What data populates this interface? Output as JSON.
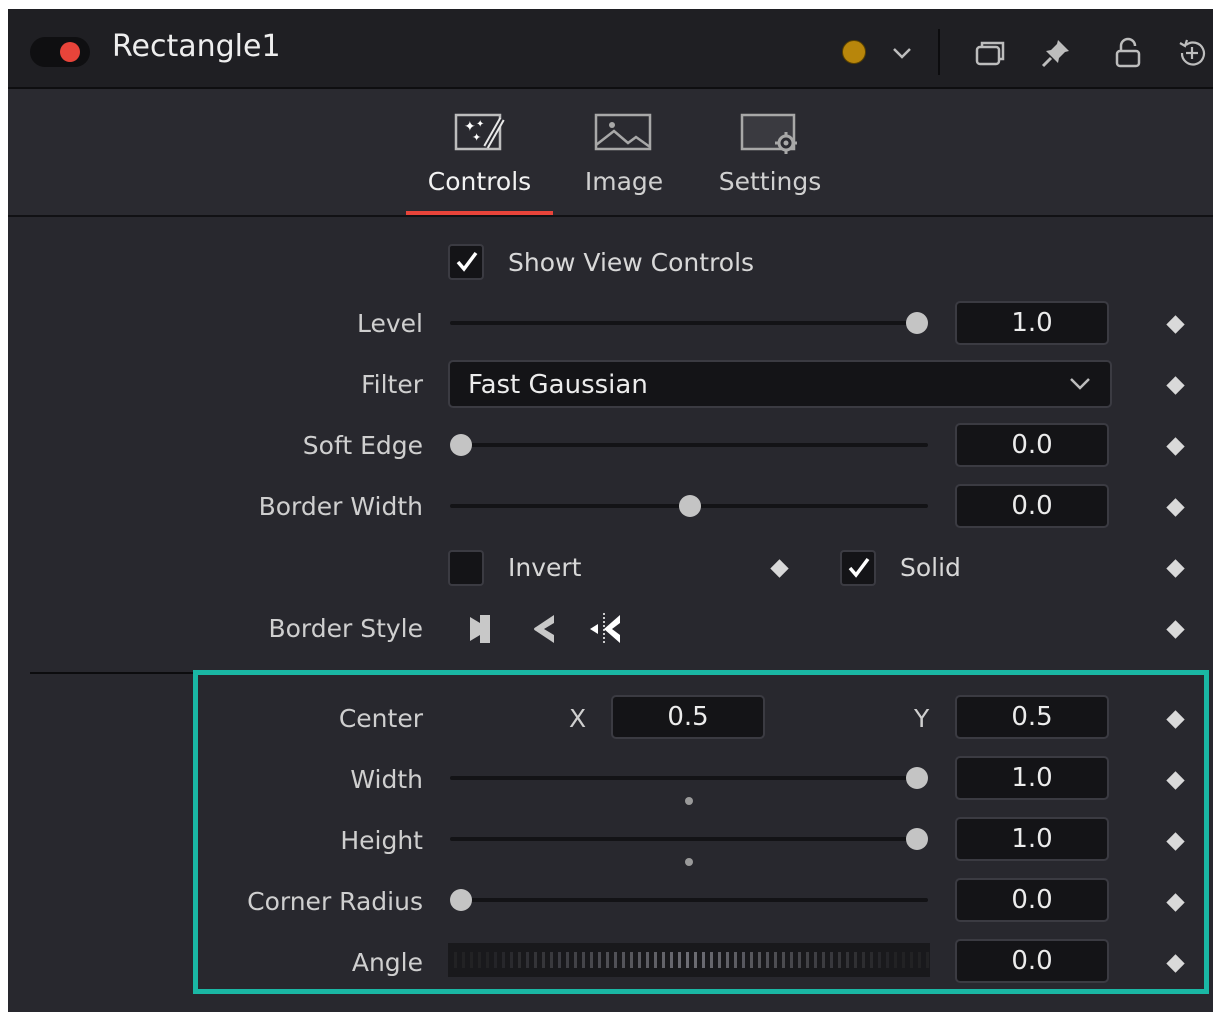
{
  "header": {
    "title": "Rectangle1",
    "node_color": "#b8860b",
    "icons": [
      "toggle-icon",
      "color-dot",
      "chevron-down-icon",
      "windows-icon",
      "pin-icon",
      "lock-icon",
      "reset-icon"
    ]
  },
  "tabs": [
    {
      "label": "Controls",
      "icon": "magic-wand-icon",
      "active": true
    },
    {
      "label": "Image",
      "icon": "image-icon",
      "active": false
    },
    {
      "label": "Settings",
      "icon": "settings-icon",
      "active": false
    }
  ],
  "controls": {
    "show_view_controls": {
      "label": "Show View Controls",
      "checked": true
    },
    "level": {
      "label": "Level",
      "value": "1.0",
      "slider_fraction": 1.0
    },
    "filter": {
      "label": "Filter",
      "value": "Fast Gaussian"
    },
    "soft_edge": {
      "label": "Soft Edge",
      "value": "0.0",
      "slider_fraction": 0.0
    },
    "border_width": {
      "label": "Border Width",
      "value": "0.0",
      "slider_fraction": 0.5
    },
    "invert": {
      "label": "Invert",
      "checked": false
    },
    "solid": {
      "label": "Solid",
      "checked": true
    },
    "border_style": {
      "label": "Border Style",
      "options": [
        "bevel-join-icon",
        "round-join-icon",
        "miter-join-icon"
      ]
    },
    "center": {
      "label": "Center",
      "x_label": "X",
      "x_value": "0.5",
      "y_label": "Y",
      "y_value": "0.5"
    },
    "width": {
      "label": "Width",
      "value": "1.0",
      "slider_fraction": 1.0
    },
    "height": {
      "label": "Height",
      "value": "1.0",
      "slider_fraction": 1.0
    },
    "corner_radius": {
      "label": "Corner Radius",
      "value": "0.0",
      "slider_fraction": 0.0
    },
    "angle": {
      "label": "Angle",
      "value": "0.0"
    }
  },
  "colors": {
    "accent_red": "#e8443a",
    "highlight_teal": "#1ab7a4",
    "panel_bg": "#28282e"
  }
}
